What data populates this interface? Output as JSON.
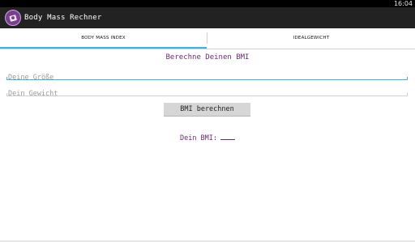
{
  "status_bar": {
    "time": "16:04"
  },
  "app": {
    "title": "Body Mass Rechner",
    "icon": "scale-icon"
  },
  "tabs": [
    {
      "label": "BODY MASS INDEX",
      "selected": true
    },
    {
      "label": "IDEALGEWICHT",
      "selected": false
    }
  ],
  "form": {
    "heading": "Berechne Deinen BMI",
    "height_placeholder": "Deine Größe",
    "height_value": "",
    "weight_placeholder": "Dein Gewicht",
    "weight_value": "",
    "button_label": "BMI berechnen"
  },
  "result": {
    "label": "Dein BMI:",
    "value": ""
  },
  "colors": {
    "accent": "#33b5e5",
    "text_purple": "#6b2b6f",
    "action_bar": "#222222"
  }
}
